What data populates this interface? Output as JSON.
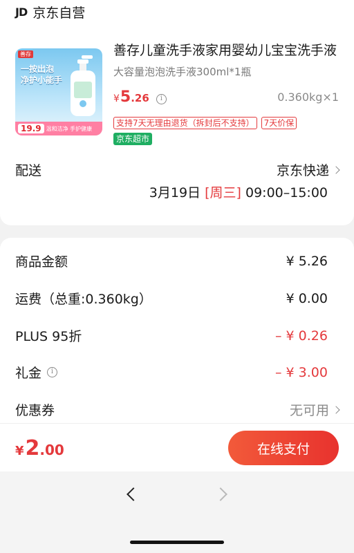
{
  "shop": {
    "logo": "JD",
    "name": "京东自营"
  },
  "product": {
    "title": "善存儿童洗手液家用婴幼儿宝宝洗手液",
    "spec": "大容量泡泡洗手液300ml*1瓶",
    "price_currency": "¥",
    "price_int": "5",
    "price_dec": ".26",
    "weight": "0.360kg×1",
    "badges": [
      "支持7天无理由退货（拆封后不支持）",
      "7天价保"
    ],
    "channel_badge": "京东超市",
    "image": {
      "brand_tag": "善存",
      "headline": "一按出泡\n净护小能手",
      "promo_price": "19.9",
      "promo_slogan": "温和洁净 手护健康"
    }
  },
  "shipping": {
    "label": "配送",
    "method": "京东快递",
    "date": "3月19日",
    "weekday": "[周三]",
    "time": "09:00–15:00"
  },
  "summary": {
    "goods_label": "商品金额",
    "goods_value": "¥ 5.26",
    "freight_label": "运费（总重:0.360kg）",
    "freight_value": "¥ 0.00",
    "plus_label": "PLUS 95折",
    "plus_value": "– ¥ 0.26",
    "gift_label": "礼金",
    "gift_value": "– ¥ 3.00",
    "coupon_label": "优惠券",
    "coupon_value": "无可用"
  },
  "pay": {
    "currency": "¥",
    "total_int": "2",
    "total_dec": ".00",
    "button": "在线支付"
  },
  "colors": {
    "accent_red": "#e4393c",
    "green_badge": "#1fae62"
  },
  "icons": [
    "info-icon",
    "chevron-right-icon",
    "back-arrow-icon",
    "forward-arrow-icon"
  ]
}
